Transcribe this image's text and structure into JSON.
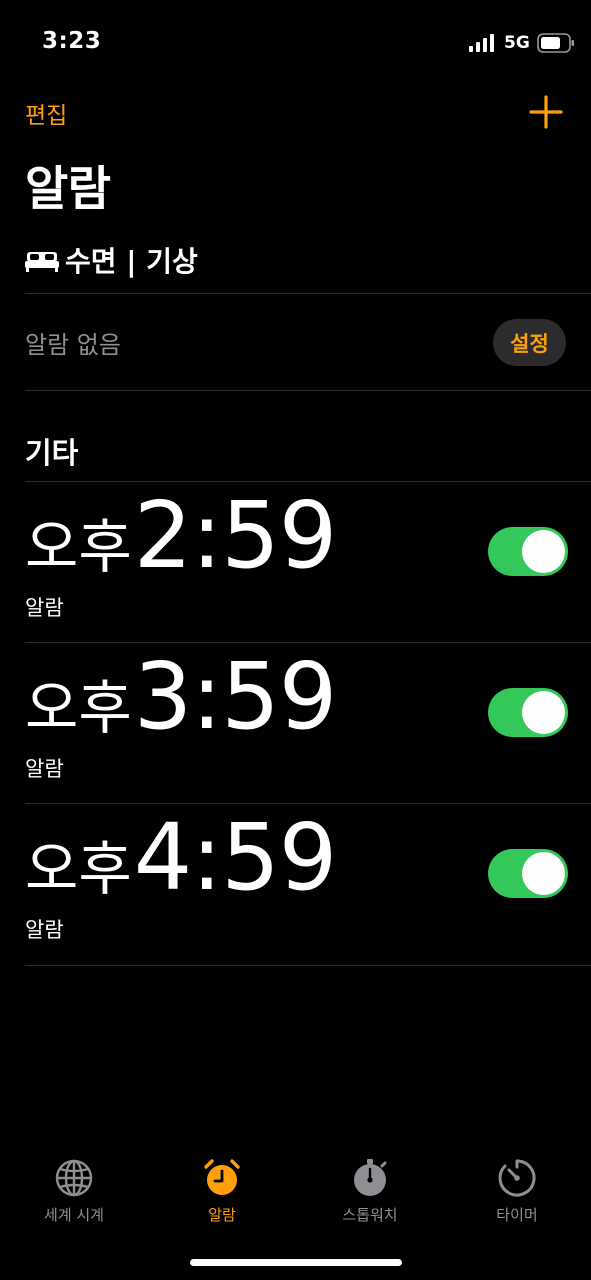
{
  "status_bar": {
    "time": "3:23",
    "network": "5G"
  },
  "nav": {
    "edit_label": "편집",
    "title": "알람"
  },
  "sleep": {
    "header": "수면 | 기상",
    "no_alarm_label": "알람 없음",
    "setup_label": "설정"
  },
  "others": {
    "header": "기타"
  },
  "alarms": [
    {
      "ampm": "오후",
      "time": "2:59",
      "label": "알람",
      "enabled": true
    },
    {
      "ampm": "오후",
      "time": "3:59",
      "label": "알람",
      "enabled": true
    },
    {
      "ampm": "오후",
      "time": "4:59",
      "label": "알람",
      "enabled": true
    }
  ],
  "tabs": [
    {
      "label": "세계 시계",
      "icon": "globe-icon",
      "active": false
    },
    {
      "label": "알람",
      "icon": "alarm-clock-icon",
      "active": true
    },
    {
      "label": "스톱워치",
      "icon": "stopwatch-icon",
      "active": false
    },
    {
      "label": "타이머",
      "icon": "timer-icon",
      "active": false
    }
  ],
  "colors": {
    "accent": "#ff9f0a",
    "toggle_on": "#34c759",
    "secondary_text": "#8e8e93",
    "background": "#000000"
  }
}
